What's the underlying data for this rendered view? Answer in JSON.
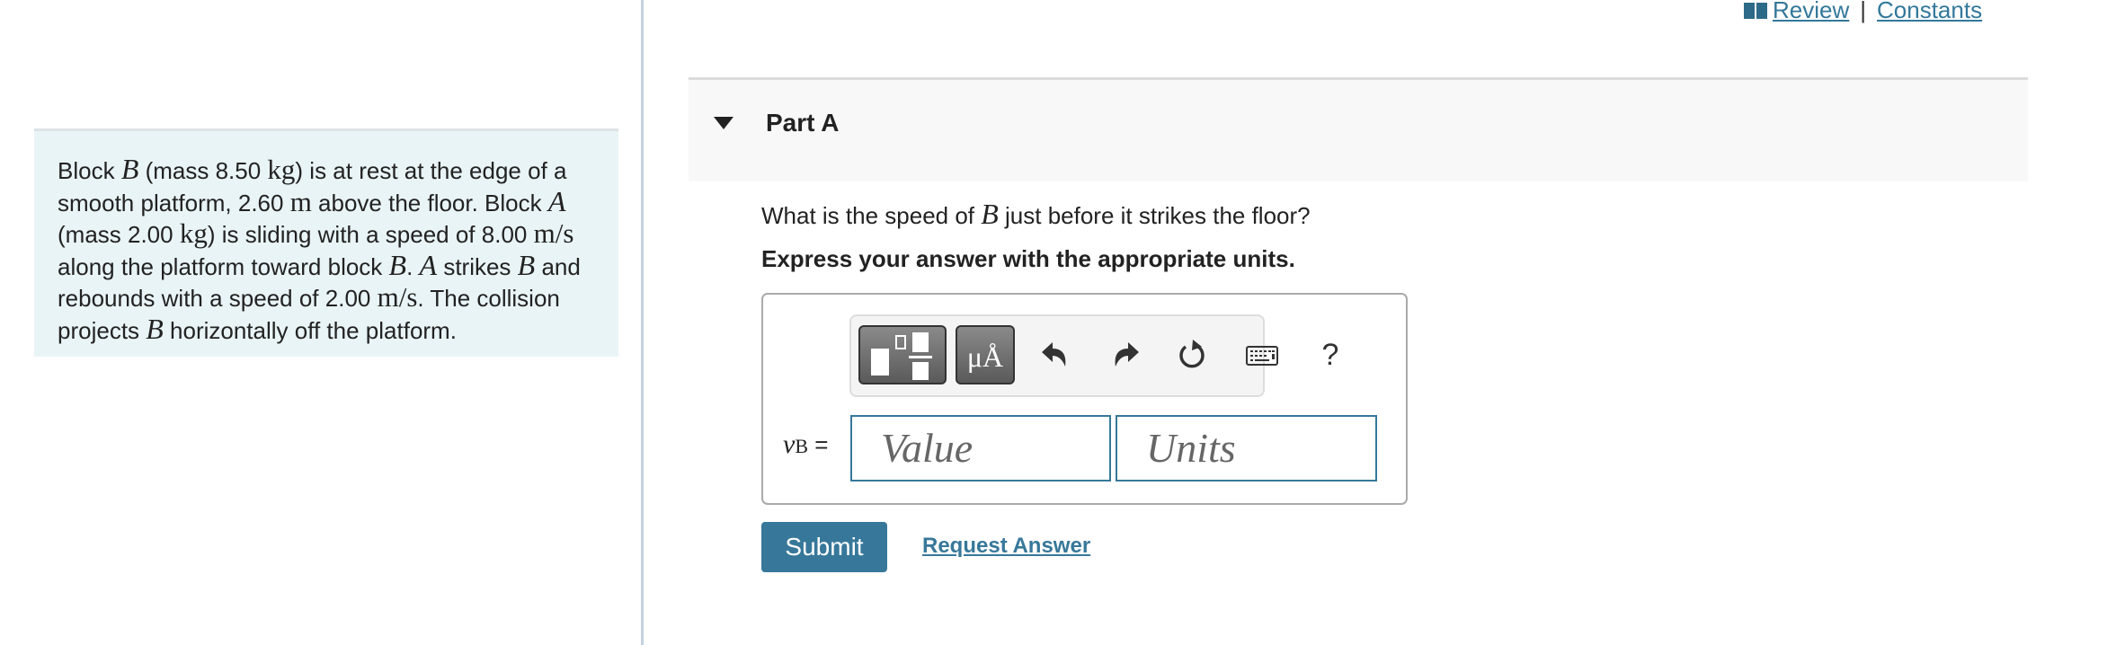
{
  "header_links": {
    "icon": "book-icon",
    "review_label": "Review",
    "separator": "|",
    "constants_label": "Constants"
  },
  "problem": {
    "segments": [
      {
        "t": "text",
        "v": "Block "
      },
      {
        "t": "math",
        "v": "B"
      },
      {
        "t": "text",
        "v": " (mass 8.50 "
      },
      {
        "t": "unit",
        "v": "kg"
      },
      {
        "t": "text",
        "v": ") is at rest at the edge of a smooth platform, 2.60 "
      },
      {
        "t": "unit",
        "v": "m"
      },
      {
        "t": "text",
        "v": " above the floor. Block "
      },
      {
        "t": "math",
        "v": "A"
      },
      {
        "t": "text",
        "v": " (mass 2.00 "
      },
      {
        "t": "unit",
        "v": "kg"
      },
      {
        "t": "text",
        "v": ") is sliding with a speed of 8.00 "
      },
      {
        "t": "unit",
        "v": "m/s"
      },
      {
        "t": "text",
        "v": " along the platform toward block "
      },
      {
        "t": "math",
        "v": "B"
      },
      {
        "t": "text",
        "v": ". "
      },
      {
        "t": "math",
        "v": "A"
      },
      {
        "t": "text",
        "v": " strikes "
      },
      {
        "t": "math",
        "v": "B"
      },
      {
        "t": "text",
        "v": " and rebounds with a speed of 2.00 "
      },
      {
        "t": "unit",
        "v": "m/s"
      },
      {
        "t": "text",
        "v": ". The collision projects "
      },
      {
        "t": "math",
        "v": "B"
      },
      {
        "t": "text",
        "v": " horizontally off the platform."
      }
    ]
  },
  "part": {
    "title": "Part A",
    "expanded": true,
    "question_before": "What is the speed of ",
    "question_var": "B",
    "question_after": " just before it strikes the floor?",
    "instruction": "Express your answer with the appropriate units."
  },
  "toolbar": {
    "templates_icon": "templates-icon",
    "units_label": "μÅ",
    "undo_icon": "undo-icon",
    "redo_icon": "redo-icon",
    "reset_icon": "reset-icon",
    "keyboard_icon": "keyboard-icon",
    "help_label": "?"
  },
  "answer": {
    "var_symbol": "v",
    "var_subscript": "B",
    "equals": "=",
    "value_placeholder": "Value",
    "units_placeholder": "Units",
    "value": "",
    "units": ""
  },
  "actions": {
    "submit_label": "Submit",
    "request_label": "Request Answer"
  },
  "colors": {
    "accent": "#37789a",
    "problem_bg": "#e9f4f7",
    "part_header_bg": "#f8f8f8"
  }
}
